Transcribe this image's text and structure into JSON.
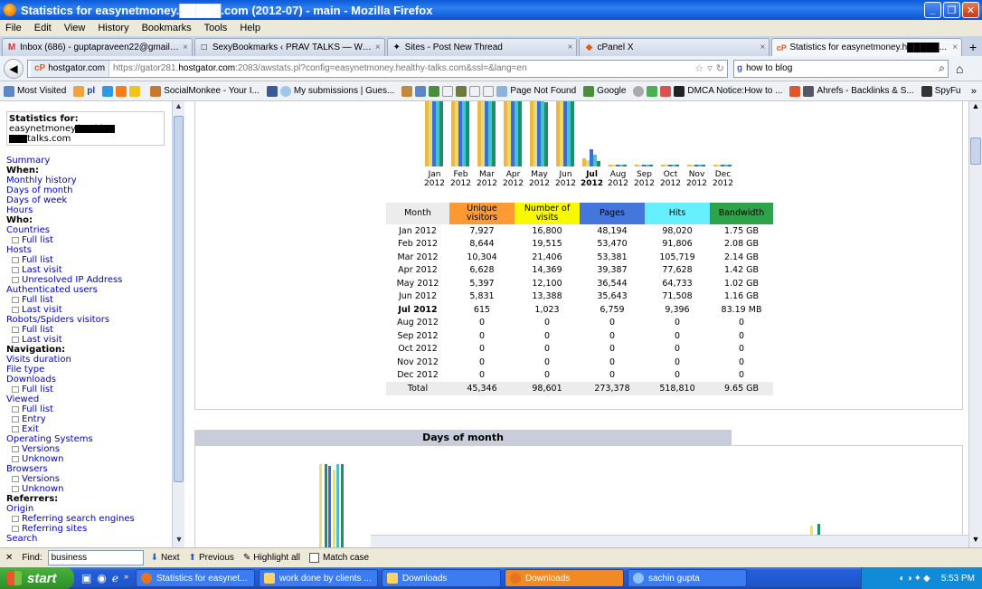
{
  "window": {
    "title": "Statistics for easynetmoney.█████.com (2012-07) - main - Mozilla Firefox"
  },
  "menu": [
    "File",
    "Edit",
    "View",
    "History",
    "Bookmarks",
    "Tools",
    "Help"
  ],
  "tabs": [
    {
      "label": "Inbox (686) - guptapraveen22@gmail.co...",
      "icon": "M"
    },
    {
      "label": "SexyBookmarks ‹ PRAV TALKS — WordPr...",
      "icon": "□"
    },
    {
      "label": "Sites - Post New Thread",
      "icon": "✦"
    },
    {
      "label": "cPanel X",
      "icon": "◆"
    },
    {
      "label": "Statistics for easynetmoney.h█████...",
      "icon": "cP"
    }
  ],
  "nav": {
    "site_badge": "hostgator.com",
    "url_prefix": "https://gator281.",
    "url_host": "hostgator.com",
    "url_rest": ":2083/awstats.pl?config=easynetmoney.healthy-talks.com&ssl=&lang=en",
    "search_value": "how to blog"
  },
  "bookmarks": [
    "Most Visited",
    "pl",
    "SocialMonkee - Your I...",
    "My submissions | Gues...",
    "Page Not Found",
    "Google",
    "DMCA Notice:How to ...",
    "Ahrefs - Backlinks & S...",
    "SpyFu"
  ],
  "sidebar": {
    "heading": "Statistics for:",
    "site_line1": "easynetmoney.healthy-",
    "site_line2": "talks.com",
    "items": [
      {
        "t": "lnk",
        "label": "Summary"
      },
      {
        "t": "sec",
        "label": "When:"
      },
      {
        "t": "lnk",
        "label": "Monthly history"
      },
      {
        "t": "lnk",
        "label": "Days of month"
      },
      {
        "t": "lnk",
        "label": "Days of week"
      },
      {
        "t": "lnk",
        "label": "Hours"
      },
      {
        "t": "sec",
        "label": "Who:"
      },
      {
        "t": "lnk",
        "label": "Countries"
      },
      {
        "t": "sub",
        "label": "Full list"
      },
      {
        "t": "lnk",
        "label": "Hosts"
      },
      {
        "t": "sub",
        "label": "Full list"
      },
      {
        "t": "sub",
        "label": "Last visit"
      },
      {
        "t": "sub",
        "label": "Unresolved IP Address"
      },
      {
        "t": "lnk",
        "label": "Authenticated users"
      },
      {
        "t": "sub",
        "label": "Full list"
      },
      {
        "t": "sub",
        "label": "Last visit"
      },
      {
        "t": "lnk",
        "label": "Robots/Spiders visitors"
      },
      {
        "t": "sub",
        "label": "Full list"
      },
      {
        "t": "sub",
        "label": "Last visit"
      },
      {
        "t": "sec",
        "label": "Navigation:"
      },
      {
        "t": "lnk",
        "label": "Visits duration"
      },
      {
        "t": "lnk",
        "label": "File type"
      },
      {
        "t": "lnk",
        "label": "Downloads"
      },
      {
        "t": "sub",
        "label": "Full list"
      },
      {
        "t": "lnk",
        "label": "Viewed"
      },
      {
        "t": "sub",
        "label": "Full list"
      },
      {
        "t": "sub",
        "label": "Entry"
      },
      {
        "t": "sub",
        "label": "Exit"
      },
      {
        "t": "lnk",
        "label": "Operating Systems"
      },
      {
        "t": "sub",
        "label": "Versions"
      },
      {
        "t": "sub",
        "label": "Unknown"
      },
      {
        "t": "lnk",
        "label": "Browsers"
      },
      {
        "t": "sub",
        "label": "Versions"
      },
      {
        "t": "sub",
        "label": "Unknown"
      },
      {
        "t": "sec",
        "label": "Referrers:"
      },
      {
        "t": "lnk",
        "label": "Origin"
      },
      {
        "t": "sub",
        "label": "Referring search engines"
      },
      {
        "t": "sub",
        "label": "Referring sites"
      },
      {
        "t": "lnk",
        "label": "Search"
      }
    ]
  },
  "monthly": {
    "headers": [
      "Month",
      "Unique visitors",
      "Number of visits",
      "Pages",
      "Hits",
      "Bandwidth"
    ],
    "rows": [
      [
        "Jan 2012",
        "7,927",
        "16,800",
        "48,194",
        "98,020",
        "1.75 GB"
      ],
      [
        "Feb 2012",
        "8,644",
        "19,515",
        "53,470",
        "91,806",
        "2.08 GB"
      ],
      [
        "Mar 2012",
        "10,304",
        "21,406",
        "53,381",
        "105,719",
        "2.14 GB"
      ],
      [
        "Apr 2012",
        "6,628",
        "14,369",
        "39,387",
        "77,628",
        "1.42 GB"
      ],
      [
        "May 2012",
        "5,397",
        "12,100",
        "36,544",
        "64,733",
        "1.02 GB"
      ],
      [
        "Jun 2012",
        "5,831",
        "13,388",
        "35,643",
        "71,508",
        "1.16 GB"
      ],
      [
        "Jul 2012",
        "615",
        "1,023",
        "6,759",
        "9,396",
        "83.19 MB"
      ],
      [
        "Aug 2012",
        "0",
        "0",
        "0",
        "0",
        "0"
      ],
      [
        "Sep 2012",
        "0",
        "0",
        "0",
        "0",
        "0"
      ],
      [
        "Oct 2012",
        "0",
        "0",
        "0",
        "0",
        "0"
      ],
      [
        "Nov 2012",
        "0",
        "0",
        "0",
        "0",
        "0"
      ],
      [
        "Dec 2012",
        "0",
        "0",
        "0",
        "0",
        "0"
      ]
    ],
    "total": [
      "Total",
      "45,346",
      "98,601",
      "273,378",
      "518,810",
      "9.65 GB"
    ],
    "current_month": "Jul 2012",
    "month_short": [
      "Jan",
      "Feb",
      "Mar",
      "Apr",
      "May",
      "Jun",
      "Jul",
      "Aug",
      "Sep",
      "Oct",
      "Nov",
      "Dec"
    ],
    "year": "2012"
  },
  "chart_data": {
    "type": "bar",
    "categories": [
      "Jan 2012",
      "Feb 2012",
      "Mar 2012",
      "Apr 2012",
      "May 2012",
      "Jun 2012",
      "Jul 2012",
      "Aug 2012",
      "Sep 2012",
      "Oct 2012",
      "Nov 2012",
      "Dec 2012"
    ],
    "series": [
      {
        "name": "Unique visitors",
        "color": "#f0b64a",
        "values": [
          7927,
          8644,
          10304,
          6628,
          5397,
          5831,
          615,
          0,
          0,
          0,
          0,
          0
        ]
      },
      {
        "name": "Number of visits",
        "color": "#e7dc6a",
        "values": [
          16800,
          19515,
          21406,
          14369,
          12100,
          13388,
          1023,
          0,
          0,
          0,
          0,
          0
        ]
      },
      {
        "name": "Pages",
        "color": "#3d6ed8",
        "values": [
          48194,
          53470,
          53381,
          39387,
          36544,
          35643,
          6759,
          0,
          0,
          0,
          0,
          0
        ]
      },
      {
        "name": "Hits",
        "color": "#43c3d6",
        "values": [
          98020,
          91806,
          105719,
          77628,
          64733,
          71508,
          9396,
          0,
          0,
          0,
          0,
          0
        ]
      },
      {
        "name": "Bandwidth",
        "color": "#1f8f6a",
        "values": [
          1.75,
          2.08,
          2.14,
          1.42,
          1.02,
          1.16,
          0.08,
          0,
          0,
          0,
          0,
          0
        ]
      }
    ]
  },
  "days_of_month": {
    "title": "Days of month"
  },
  "findbar": {
    "label": "Find:",
    "value": "business",
    "next": "Next",
    "previous": "Previous",
    "highlight": "Highlight all",
    "match_case": "Match case"
  },
  "taskbar": {
    "start": "start",
    "tasks": [
      "Statistics for easynet...",
      "work done by clients ...",
      "Downloads",
      "Downloads",
      "sachin gupta"
    ],
    "clock": "5:53 PM"
  }
}
